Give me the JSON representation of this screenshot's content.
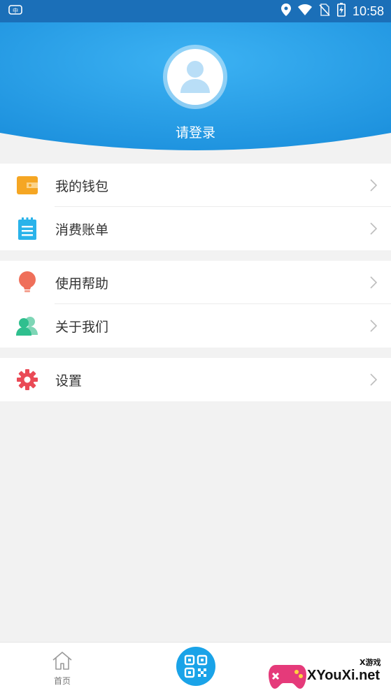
{
  "status_bar": {
    "time": "10:58",
    "icons": [
      "app-notification-icon",
      "location-icon",
      "wifi-icon",
      "no-sim-icon",
      "battery-icon"
    ]
  },
  "header": {
    "login_prompt": "请登录",
    "colors": {
      "gradient_top": "#2aa2ec",
      "gradient_bottom": "#1e8fdd"
    }
  },
  "menu": {
    "groups": [
      {
        "items": [
          {
            "label": "我的钱包",
            "icon": "wallet-icon",
            "color": "#f5a623"
          },
          {
            "label": "消费账单",
            "icon": "bill-icon",
            "color": "#2ab3ea"
          }
        ]
      },
      {
        "items": [
          {
            "label": "使用帮助",
            "icon": "lightbulb-icon",
            "color": "#ef6f5a"
          },
          {
            "label": "关于我们",
            "icon": "users-icon",
            "color": "#2fbf8e"
          }
        ]
      },
      {
        "items": [
          {
            "label": "设置",
            "icon": "gear-icon",
            "color": "#ea4a56"
          }
        ]
      }
    ]
  },
  "bottom_nav": {
    "home_label": "首页",
    "scan_icon": "qr-scan-icon",
    "watermark_text": "XYouXi.net",
    "watermark_small": "X游戏"
  }
}
